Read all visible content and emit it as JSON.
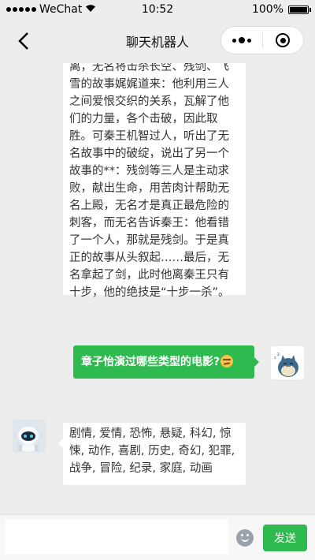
{
  "status_bar": {
    "carrier": "WeChat",
    "time": "10:52",
    "battery": "100%",
    "battery_level": 1.0
  },
  "nav": {
    "title": "聊天机器人"
  },
  "messages": [
    {
      "sender": "bot",
      "lines": [
        "离，无名将击杀长空、残剑、飞",
        "雪的故事娓娓道来：他利用三人",
        "之间爱恨交织的关系，瓦解了他",
        "们的力量，各个击破，因此取",
        "胜。可秦王机智过人，听出了无",
        "名故事中的破绽，说出了另一个",
        "故事的**：残剑等三人是主动求",
        "败，献出生命，用苦肉计帮助无",
        "名上殿，无名才是真正最危险的",
        "刺客，而无名告诉秦王：他看错",
        "了一个人，那就是残剑。于是真",
        "正的故事从头叙起……最后，无",
        "名拿起了剑，此时他离秦王只有",
        "十步，他的绝技是“十步一杀”。"
      ]
    },
    {
      "sender": "user",
      "text": "章子怡演过哪些类型的电影?",
      "emoji": "smirk-emoji"
    },
    {
      "sender": "bot",
      "lines": [
        "剧情, 爱情, 恐怖, 悬疑, 科幻, 惊",
        "悚, 动作, 喜剧, 历史, 奇幻, 犯罪,",
        "战争, 冒险, 纪录, 家庭, 动画"
      ]
    }
  ],
  "input": {
    "value": "",
    "placeholder": "",
    "send_label": "发送"
  },
  "colors": {
    "accent": "#2eba4e",
    "background": "#ededed",
    "bubble": "#ffffff"
  }
}
